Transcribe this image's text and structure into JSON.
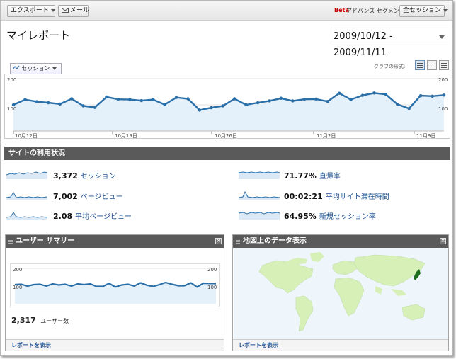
{
  "toolbar": {
    "export_label": "エクスポート",
    "mail_label": "メール",
    "beta_label": "Beta",
    "advanced_segment_label": "アドバンス セグメント",
    "segment_select_value": "全セッション"
  },
  "header": {
    "title": "マイレポート",
    "date_range": "2009/10/12 - 2009/11/11"
  },
  "main_chart": {
    "metric_select_value": "セッション",
    "graph_format_label": "グラフの形式:",
    "y_ticks": [
      "200",
      "100"
    ],
    "y_ticks_right": [
      "200",
      "100"
    ],
    "x_labels": [
      "10月12日",
      "10月19日",
      "10月26日",
      "11月2日",
      "11月9日"
    ],
    "line_color": "#2a6fa8",
    "fill_color": "#e4f0fa"
  },
  "chart_data": [
    {
      "type": "area",
      "title": "",
      "ylim": [
        0,
        200
      ],
      "series": [
        {
          "values": [
            100,
            120,
            112,
            108,
            103,
            123,
            96,
            90,
            130,
            121,
            120,
            116,
            120,
            101,
            128,
            123,
            80,
            89,
            96,
            123,
            100,
            108,
            115,
            125,
            115,
            121,
            122,
            113,
            144,
            120,
            136,
            145,
            140,
            102,
            86,
            135,
            133,
            137
          ]
        }
      ],
      "x_tick_labels": [
        "10月12日",
        "10月19日",
        "10月26日",
        "11月2日",
        "11月9日"
      ]
    },
    {
      "type": "area",
      "title": "",
      "ylim": [
        0,
        200
      ],
      "series": [
        {
          "values": [
            108,
            110,
            100,
            108,
            110,
            100,
            112,
            106,
            110,
            100,
            112,
            108,
            112,
            98,
            98,
            115,
            95,
            106,
            110,
            100,
            118,
            105,
            98,
            108,
            120,
            110,
            102,
            102,
            118,
            95,
            116,
            115,
            114
          ]
        }
      ]
    }
  ],
  "site_usage": {
    "title": "サイトの利用状況",
    "stats": [
      {
        "value": "3,372",
        "label": "セッション"
      },
      {
        "value": "7,002",
        "label": "ページビュー"
      },
      {
        "value": "2.08",
        "label": "平均ページビュー"
      },
      {
        "value": "71.77%",
        "label": "直帰率"
      },
      {
        "value": "00:02:21",
        "label": "平均サイト滞在時間"
      },
      {
        "value": "64.95%",
        "label": "新規セッション率"
      }
    ]
  },
  "user_summary": {
    "title": "ユーザー サマリー",
    "y_ticks": [
      "200",
      "100"
    ],
    "value": "2,317",
    "value_label": "ユーザー数",
    "link": "レポートを表示"
  },
  "map_overlay": {
    "title": "地図上のデータ表示",
    "link": "レポートを表示",
    "highlight_color": "#1c6d1c",
    "land_color": "#d7f0b8",
    "ocean_color": "#eef5fb"
  },
  "icons": {
    "close": "close-icon",
    "grip": "grip-icon",
    "mail": "mail-icon"
  }
}
